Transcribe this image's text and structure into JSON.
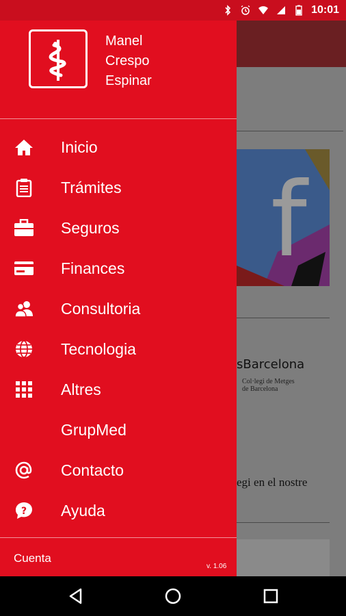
{
  "status_bar": {
    "time": "10:01"
  },
  "drawer": {
    "user_name_lines": [
      "Manel",
      "Crespo",
      "Espinar"
    ],
    "items": [
      {
        "label": "Inicio",
        "icon": "home-icon"
      },
      {
        "label": "Trámites",
        "icon": "clipboard-icon"
      },
      {
        "label": "Seguros",
        "icon": "briefcase-icon"
      },
      {
        "label": "Finances",
        "icon": "credit-card-icon"
      },
      {
        "label": "Consultoria",
        "icon": "people-icon"
      },
      {
        "label": "Tecnologia",
        "icon": "globe-icon"
      },
      {
        "label": "Altres",
        "icon": "grid-icon"
      },
      {
        "label": "GrupMed",
        "icon": ""
      },
      {
        "label": "Contacto",
        "icon": "at-sign-icon"
      },
      {
        "label": "Ayuda",
        "icon": "help-chat-icon"
      }
    ],
    "footer_label": "Cuenta",
    "version": "v. 1.06"
  },
  "background": {
    "banner_text": "f",
    "org_name": "sBarcelona",
    "org_sub_line1": "Col·legi de Metges",
    "org_sub_line2": "de Barcelona",
    "article_snippet": "egi en el nostre"
  },
  "colors": {
    "drawer": "#e10e1f",
    "status_bar": "#c90e1e",
    "nav_bar": "#000000"
  }
}
